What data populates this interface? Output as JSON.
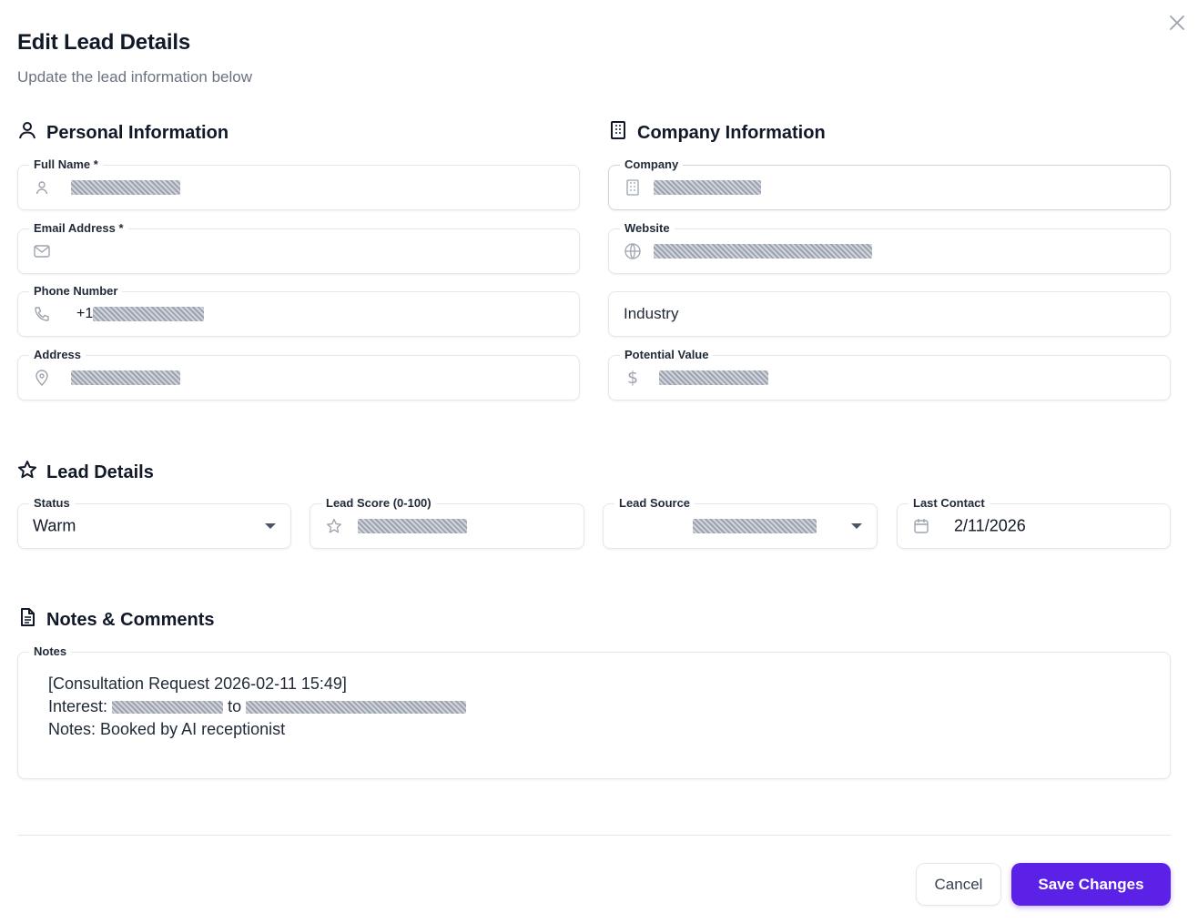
{
  "dialog": {
    "title": "Edit Lead Details",
    "subtitle": "Update the lead information below"
  },
  "sections": {
    "personal": "Personal Information",
    "company": "Company Information",
    "lead": "Lead Details",
    "notes": "Notes & Comments"
  },
  "personal": {
    "full_name": {
      "label": "Full Name *",
      "value": ""
    },
    "email": {
      "label": "Email Address *",
      "value": ""
    },
    "phone": {
      "label": "Phone Number",
      "value": "+1"
    },
    "address": {
      "label": "Address",
      "value": ""
    }
  },
  "company": {
    "company": {
      "label": "Company",
      "value": ""
    },
    "website": {
      "label": "Website",
      "value": ""
    },
    "industry": {
      "placeholder": "Industry"
    },
    "potential_value": {
      "label": "Potential Value",
      "value": ""
    }
  },
  "lead": {
    "status": {
      "label": "Status",
      "value": "Warm"
    },
    "score": {
      "label": "Lead Score (0-100)",
      "value": ""
    },
    "source": {
      "label": "Lead Source",
      "value": ""
    },
    "last_contact": {
      "label": "Last Contact",
      "value": "2/11/2026"
    }
  },
  "notes": {
    "label": "Notes",
    "line1": "[Consultation Request 2026-02-11 15:49]",
    "line2_prefix": "Interest:",
    "line2_mid": "to",
    "line3": "Notes: Booked by AI receptionist"
  },
  "footer": {
    "cancel": "Cancel",
    "save": "Save Changes"
  },
  "colors": {
    "primary": "#5b21e6",
    "border": "#e5e7eb",
    "muted_text": "#6b7280"
  }
}
